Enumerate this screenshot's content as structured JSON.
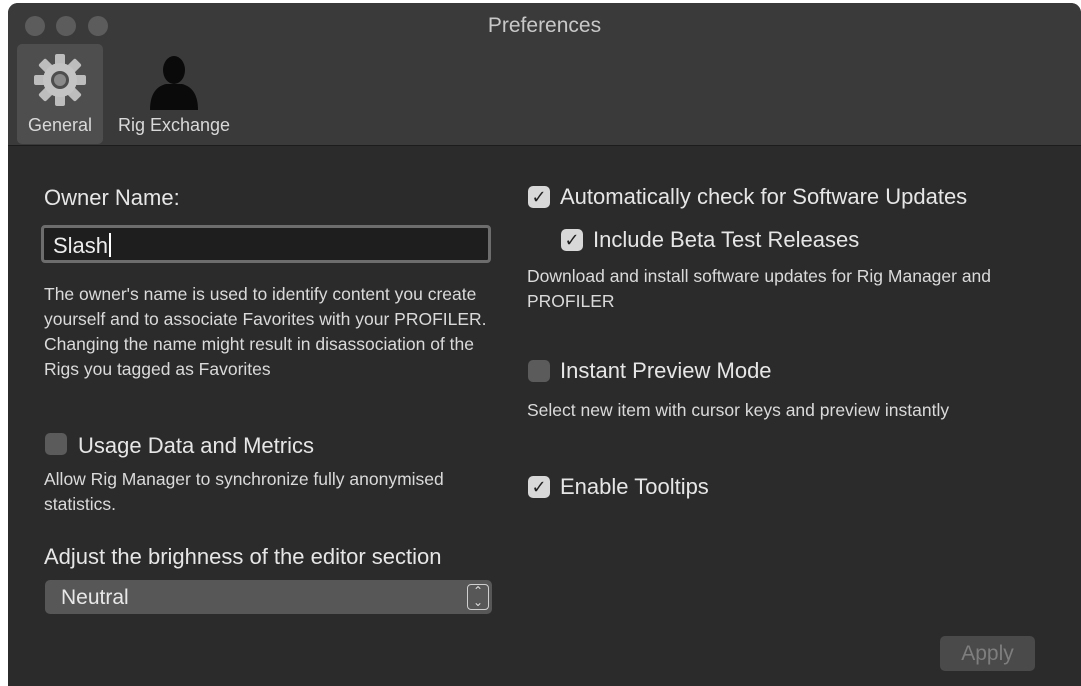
{
  "window": {
    "title": "Preferences"
  },
  "tabs": [
    {
      "label": "General",
      "icon": "gear-icon",
      "selected": true
    },
    {
      "label": "Rig Exchange",
      "icon": "person-silhouette-icon",
      "selected": false
    }
  ],
  "owner": {
    "label": "Owner Name:",
    "value": "Slash",
    "description": "The owner's name is used to identify content you create yourself and to associate Favorites with your PROFILER. Changing the name might result in disassociation of the Rigs you tagged as Favorites"
  },
  "usage": {
    "label": "Usage Data and Metrics",
    "checked": false,
    "description": "Allow Rig Manager to synchronize fully anonymised statistics."
  },
  "brightness": {
    "label": "Adjust the brighness of the editor section",
    "selected": "Neutral"
  },
  "updates": {
    "label": "Automatically check for Software Updates",
    "checked": true,
    "beta_label": "Include Beta Test Releases",
    "beta_checked": true,
    "description": "Download and install software updates for Rig Manager and PROFILER"
  },
  "preview": {
    "label": "Instant Preview Mode",
    "checked": false,
    "description": "Select new item with cursor keys and preview instantly"
  },
  "tooltips": {
    "label": "Enable Tooltips",
    "checked": true
  },
  "apply_label": "Apply",
  "colors": {
    "window_bg": "#2b2b2b",
    "toolbar_bg": "#3a3a3a",
    "selected_tab": "#4e4e4e"
  }
}
